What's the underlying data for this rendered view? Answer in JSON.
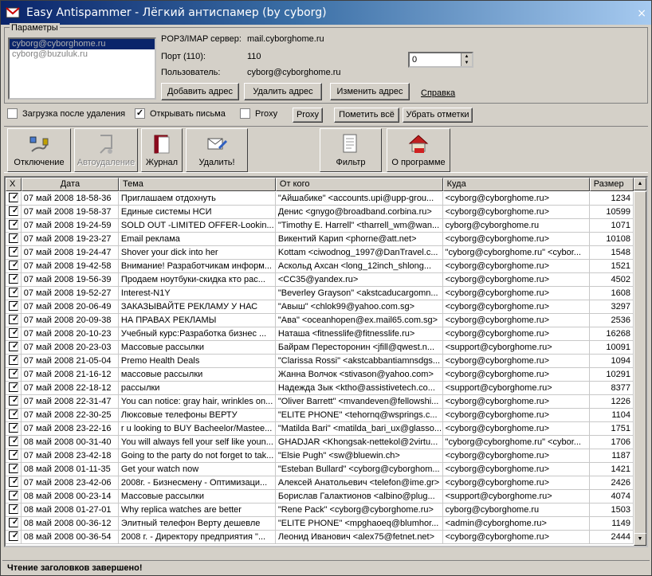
{
  "window": {
    "title": "Easy Antispammer - Лёгкий антиспамер (by cyborg)",
    "close": "×"
  },
  "params": {
    "legend": "Параметры",
    "accounts": [
      "cyborg@cyborghome.ru",
      "cyborg@buzuluk.ru"
    ],
    "server_label": "POP3/IMAP сервер:",
    "server_value": "mail.cyborghome.ru",
    "port_label": "Порт (110):",
    "port_value": "110",
    "user_label": "Пользователь:",
    "user_value": "cyborg@cyborghome.ru",
    "spin_value": "0",
    "add_btn": "Добавить адрес",
    "del_btn": "Удалить адрес",
    "edit_btn": "Изменить адрес",
    "help_link": "Справка"
  },
  "options": {
    "load_after_delete": {
      "label": "Загрузка после удаления",
      "checked": false
    },
    "open_letters": {
      "label": "Открывать письма",
      "checked": true
    },
    "proxy": {
      "label": "Proxy",
      "checked": false
    },
    "proxy_btn": "Proxy",
    "mark_all_btn": "Пометить всё",
    "unmark_btn": "Убрать отметки"
  },
  "toolbar": {
    "disconnect": "Отключение",
    "autodelete": "Автоудаление",
    "journal": "Журнал",
    "delete": "Удалить!",
    "filter": "Фильтр",
    "about": "О программе"
  },
  "table": {
    "headers": [
      "X",
      "Дата",
      "Тема",
      "От кого",
      "Куда",
      "Размер"
    ],
    "rows": [
      [
        "07 май 2008 18-58-36",
        "Приглашаем отдохнуть",
        "\"Айшабике\" <accounts.upi@upp-grou...",
        "<cyborg@cyborghome.ru>",
        "1234"
      ],
      [
        "07 май 2008 19-58-37",
        "Единые системы НСИ",
        "Денис <gnygo@broadband.corbina.ru>",
        "<cyborg@cyborghome.ru>",
        "10599"
      ],
      [
        "07 май 2008 19-24-59",
        "SOLD OUT -LIMITED OFFER-Lookin...",
        "\"Timothy E. Harrell\" <tharrell_wm@wan...",
        "cyborg@cyborghome.ru",
        "1071"
      ],
      [
        "07 май 2008 19-23-27",
        "Email реклама",
        "Викентий Карип <phorne@att.net>",
        "<cyborg@cyborghome.ru>",
        "10108"
      ],
      [
        "07 май 2008 19-24-47",
        "Shover your dick into her",
        "Kottam <ciwodnog_1997@DanTravel.c...",
        "\"cyborg@cyborghome.ru\" <cybor...",
        "1548"
      ],
      [
        "07 май 2008 19-42-58",
        "Внимание! Разработчикам информ...",
        "Аскольд Ахсан <long_12inch_shlong...",
        "<cyborg@cyborghome.ru>",
        "1521"
      ],
      [
        "07 май 2008 19-56-39",
        "Продаем ноутбуки-скидка кто рас...",
        "<CC35@yandex.ru>",
        "<cyborg@cyborghome.ru>",
        "4502"
      ],
      [
        "07 май 2008 19-52-27",
        "Interest-N1Y",
        "\"Beverley Grayson\" <akstcaducargomn...",
        "<cyborg@cyborghome.ru>",
        "1608"
      ],
      [
        "07 май 2008 20-06-49",
        "ЗАКАЗЫВАЙТЕ РЕКЛАМУ У НАС",
        "\"Авыш\" <chlok99@yahoo.com.sg>",
        "<cyborg@cyborghome.ru>",
        "3297"
      ],
      [
        "07 май 2008 20-09-38",
        "НА ПРАВАХ РЕКЛАМЫ",
        "\"Ава\" <oceanhopen@ex.mail65.com.sg>",
        "<cyborg@cyborghome.ru>",
        "2536"
      ],
      [
        "07 май 2008 20-10-23",
        "Учебный курс:Разработка бизнес ...",
        "Наташа <fitnesslife@fitnesslife.ru>",
        "<cyborg@cyborghome.ru>",
        "16268"
      ],
      [
        "07 май 2008 20-23-03",
        "Массовые рассылки",
        "Байрам Пересторонин <jfill@qwest.n...",
        "<support@cyborghome.ru>",
        "10091"
      ],
      [
        "07 май 2008 21-05-04",
        "Premo Health Deals",
        "\"Clarissa Rossi\" <akstcabbantiamnsdgs...",
        "<cyborg@cyborghome.ru>",
        "1094"
      ],
      [
        "07 май 2008 21-16-12",
        "массовые рассылки",
        "Жанна Волчок <stivason@yahoo.com>",
        "<cyborg@cyborghome.ru>",
        "10291"
      ],
      [
        "07 май 2008 22-18-12",
        "рассылки",
        "Надежда Зык <ktho@assistivetech.co...",
        "<support@cyborghome.ru>",
        "8377"
      ],
      [
        "07 май 2008 22-31-47",
        "You can notice: gray hair, wrinkles on...",
        "\"Oliver Barrett\" <mvandeven@fellowshi...",
        "<cyborg@cyborghome.ru>",
        "1226"
      ],
      [
        "07 май 2008 22-30-25",
        "Люксовые телефоны ВЕРТУ",
        "\"ELITE PHONE\" <tehornq@wsprings.c...",
        "<cyborg@cyborghome.ru>",
        "1104"
      ],
      [
        "07 май 2008 23-22-16",
        "r u looking to BUY Bacheelor/Mastee...",
        "\"Matilda Bari\" <matilda_bari_ux@glasso...",
        "<cyborg@cyborghome.ru>",
        "1751"
      ],
      [
        "08 май 2008 00-31-40",
        "You will always fell your self like youn...",
        "GHADJAR <Khongsak-nettekol@2virtu...",
        "\"cyborg@cyborghome.ru\" <cybor...",
        "1706"
      ],
      [
        "07 май 2008 23-42-18",
        "Going to the party do not forget to tak...",
        "\"Elsie Pugh\" <sw@bluewin.ch>",
        "<cyborg@cyborghome.ru>",
        "1187"
      ],
      [
        "08 май 2008 01-11-35",
        "Get your watch now",
        "\"Esteban Bullard\" <cyborg@cyborghom...",
        "<cyborg@cyborghome.ru>",
        "1421"
      ],
      [
        "07 май 2008 23-42-06",
        "2008г. - Бизнесмену - Оптимизаци...",
        "Алексей Анатольевич <telefon@ime.gr>",
        "<cyborg@cyborghome.ru>",
        "2426"
      ],
      [
        "08 май 2008 00-23-14",
        "Массовые рассылки",
        "Борислав Галактионов <albino@plug...",
        "<support@cyborghome.ru>",
        "4074"
      ],
      [
        "08 май 2008 01-27-01",
        "Why replica watches are better",
        "\"Rene Pack\" <cyborg@cyborghome.ru>",
        "cyborg@cyborghome.ru",
        "1503"
      ],
      [
        "08 май 2008 00-36-12",
        "Элитный телефон Верту дешевле",
        "\"ELITE PHONE\" <mpghaoeq@blumhor...",
        "<admin@cyborghome.ru>",
        "1149"
      ],
      [
        "08 май 2008 00-36-54",
        "2008 г. - Директору предприятия \"...",
        "Леонид Иванович <alex75@fetnet.net>",
        "<cyborg@cyborghome.ru>",
        "2444"
      ]
    ]
  },
  "status": "Чтение заголовков завершено!"
}
